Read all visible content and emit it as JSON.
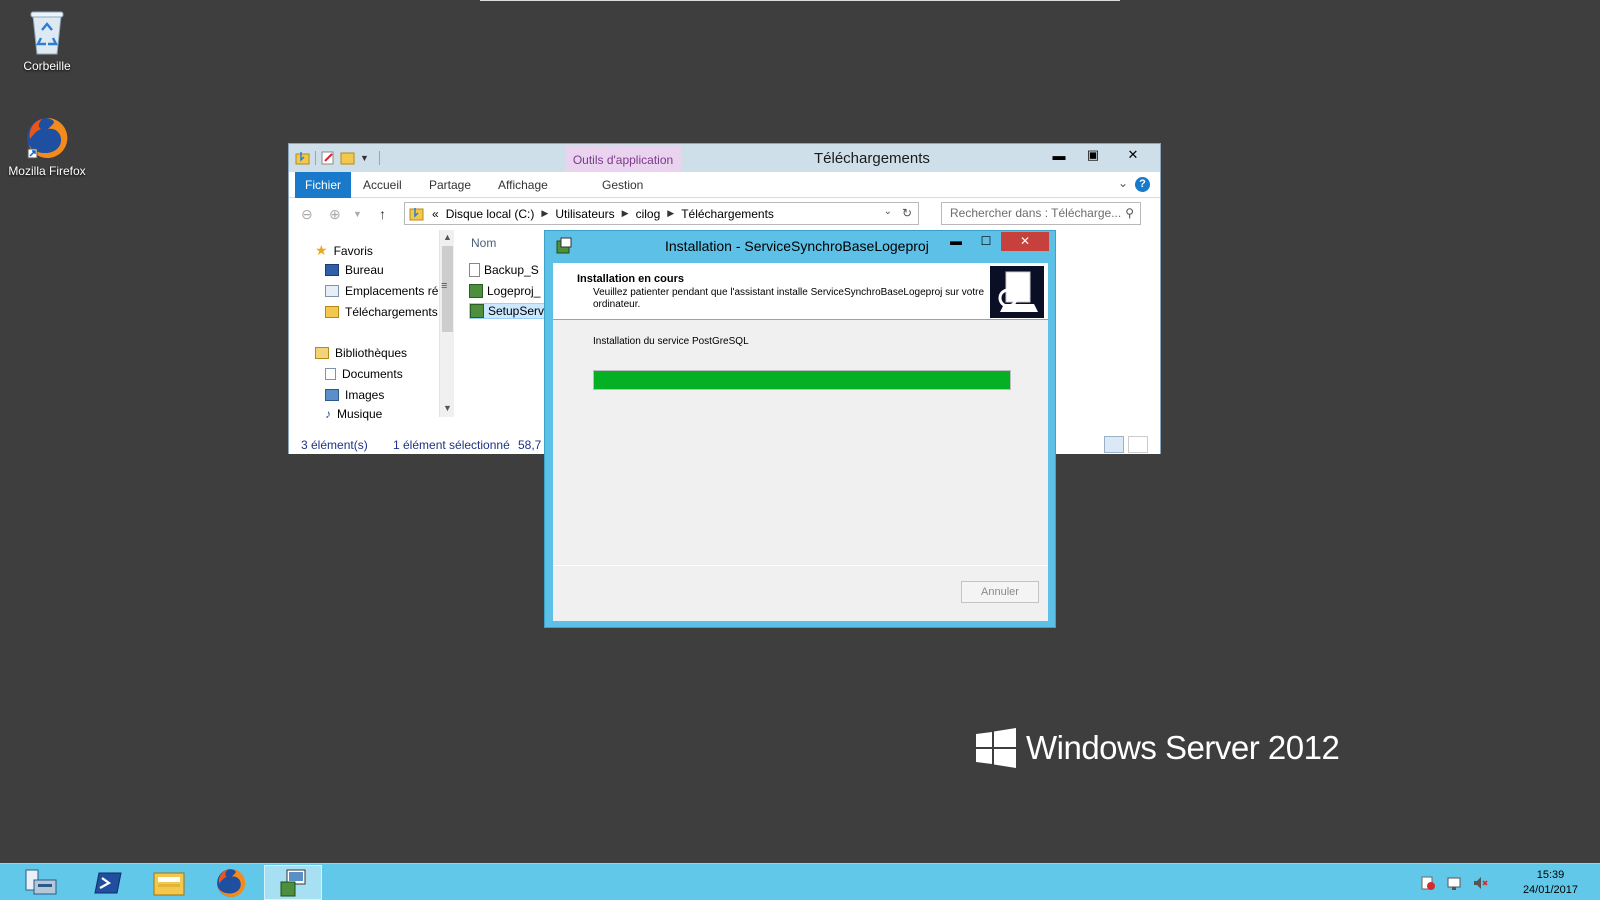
{
  "desktop": {
    "icons": [
      {
        "label": "Corbeille"
      },
      {
        "label": "Mozilla Firefox"
      }
    ],
    "watermark": {
      "text": "Windows Server 2012"
    }
  },
  "explorer": {
    "title": "Téléchargements",
    "context_tab": "Outils d'application",
    "ribbon_tabs": [
      "Fichier",
      "Accueil",
      "Partage",
      "Affichage",
      "Gestion"
    ],
    "address": {
      "prefix": "«",
      "crumbs": [
        "Disque local (C:)",
        "Utilisateurs",
        "cilog",
        "Téléchargements"
      ]
    },
    "search_placeholder": "Rechercher dans : Télécharge...",
    "nav": {
      "favorites_label": "Favoris",
      "favorites": [
        "Bureau",
        "Emplacements ré",
        "Téléchargements"
      ],
      "libraries_label": "Bibliothèques",
      "libraries": [
        "Documents",
        "Images",
        "Musique"
      ]
    },
    "column_header": "Nom",
    "files": [
      "Backup_S",
      "Logeproj_",
      "SetupServ"
    ],
    "status": {
      "count": "3 élément(s)",
      "selected": "1 élément sélectionné",
      "size": "58,7 M"
    }
  },
  "installer": {
    "title": "Installation - ServiceSynchroBaseLogeproj",
    "heading": "Installation en cours",
    "description": "Veuillez patienter pendant que l'assistant installe ServiceSynchroBaseLogeproj sur votre ordinateur.",
    "status_text": "Installation du service PostGreSQL",
    "progress_fraction": 1.0,
    "cancel_label": "Annuler"
  },
  "taskbar": {
    "apps": [
      "server-manager-icon",
      "powershell-icon",
      "file-explorer-icon",
      "firefox-icon",
      "installer-icon"
    ],
    "clock_time": "15:39",
    "clock_date": "24/01/2017"
  },
  "colors": {
    "desktop_bg": "#3e3e3e",
    "taskbar_bg": "#62c8ea",
    "installer_frame": "#5dc0e6",
    "progress_fill": "#06b025",
    "file_tab": "#1979ca"
  }
}
